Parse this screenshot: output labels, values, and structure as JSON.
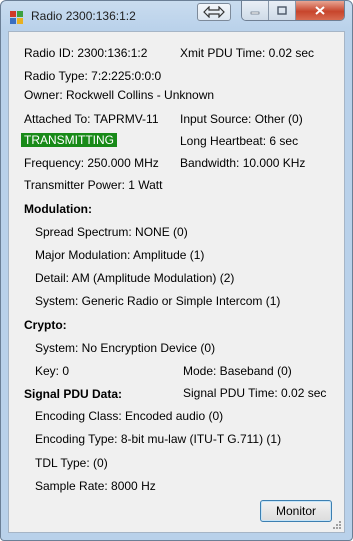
{
  "window": {
    "title": "Radio 2300:136:1:2"
  },
  "fields": {
    "radio_id": "Radio ID: 2300:136:1:2",
    "xmit_pdu_time": "Xmit PDU Time: 0.02 sec",
    "radio_type": "Radio Type: 7:2:225:0:0:0",
    "owner": "Owner: Rockwell Collins - Unknown",
    "attached_to": "Attached To: TAPRMV-11",
    "input_source": "Input Source: Other (0)",
    "status": "TRANSMITTING",
    "long_heartbeat": "Long Heartbeat: 6 sec",
    "frequency": "Frequency: 250.000 MHz",
    "bandwidth": "Bandwidth: 10.000 KHz",
    "transmitter_power": "Transmitter Power: 1 Watt"
  },
  "modulation": {
    "header": "Modulation:",
    "spread_spectrum": "Spread Spectrum: NONE (0)",
    "major_modulation": "Major Modulation: Amplitude (1)",
    "detail": "Detail: AM (Amplitude Modulation) (2)",
    "system": "System: Generic Radio or Simple Intercom (1)"
  },
  "crypto": {
    "header": "Crypto:",
    "system": "System: No Encryption Device (0)",
    "key": "Key: 0",
    "mode": "Mode: Baseband (0)"
  },
  "signal_pdu": {
    "header": "Signal PDU Data:",
    "time": "Signal PDU Time: 0.02 sec",
    "encoding_class": "Encoding Class: Encoded audio (0)",
    "encoding_type": "Encoding Type: 8-bit mu-law (ITU-T G.711) (1)",
    "tdl_type": "TDL Type:  (0)",
    "sample_rate": "Sample Rate: 8000 Hz"
  },
  "buttons": {
    "monitor": "Monitor"
  },
  "colors": {
    "status_bg": "#188a18",
    "status_fg": "#ffffff"
  },
  "icons": {
    "app": "radio-app-icon",
    "restore": "restore-arrows-icon",
    "minimize": "minimize-icon",
    "maximize": "maximize-icon",
    "close": "close-icon"
  }
}
